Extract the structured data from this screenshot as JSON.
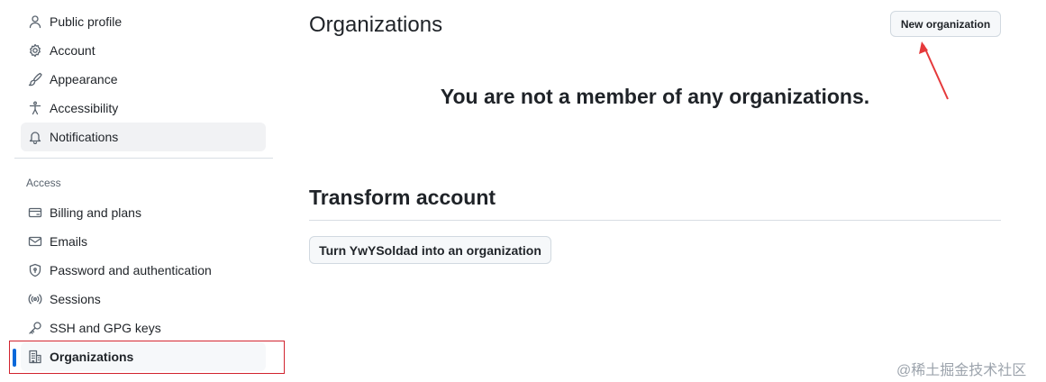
{
  "sidebar": {
    "items_top": [
      {
        "label": "Public profile",
        "icon": "person-icon"
      },
      {
        "label": "Account",
        "icon": "gear-icon"
      },
      {
        "label": "Appearance",
        "icon": "paintbrush-icon"
      },
      {
        "label": "Accessibility",
        "icon": "accessibility-icon"
      },
      {
        "label": "Notifications",
        "icon": "bell-icon"
      }
    ],
    "section_access": "Access",
    "items_access": [
      {
        "label": "Billing and plans",
        "icon": "credit-card-icon"
      },
      {
        "label": "Emails",
        "icon": "mail-icon"
      },
      {
        "label": "Password and authentication",
        "icon": "shield-lock-icon"
      },
      {
        "label": "Sessions",
        "icon": "broadcast-icon"
      },
      {
        "label": "SSH and GPG keys",
        "icon": "key-icon"
      },
      {
        "label": "Organizations",
        "icon": "organization-icon"
      }
    ]
  },
  "main": {
    "title": "Organizations",
    "new_org_button": "New organization",
    "empty_message": "You are not a member of any organizations.",
    "transform_heading": "Transform account",
    "transform_button": "Turn YwYSoldad into an organization"
  },
  "watermark": "@稀土掘金技术社区",
  "colors": {
    "accent": "#0969da",
    "highlight_box": "#d1242f",
    "annotation_arrow": "#e5393b"
  }
}
